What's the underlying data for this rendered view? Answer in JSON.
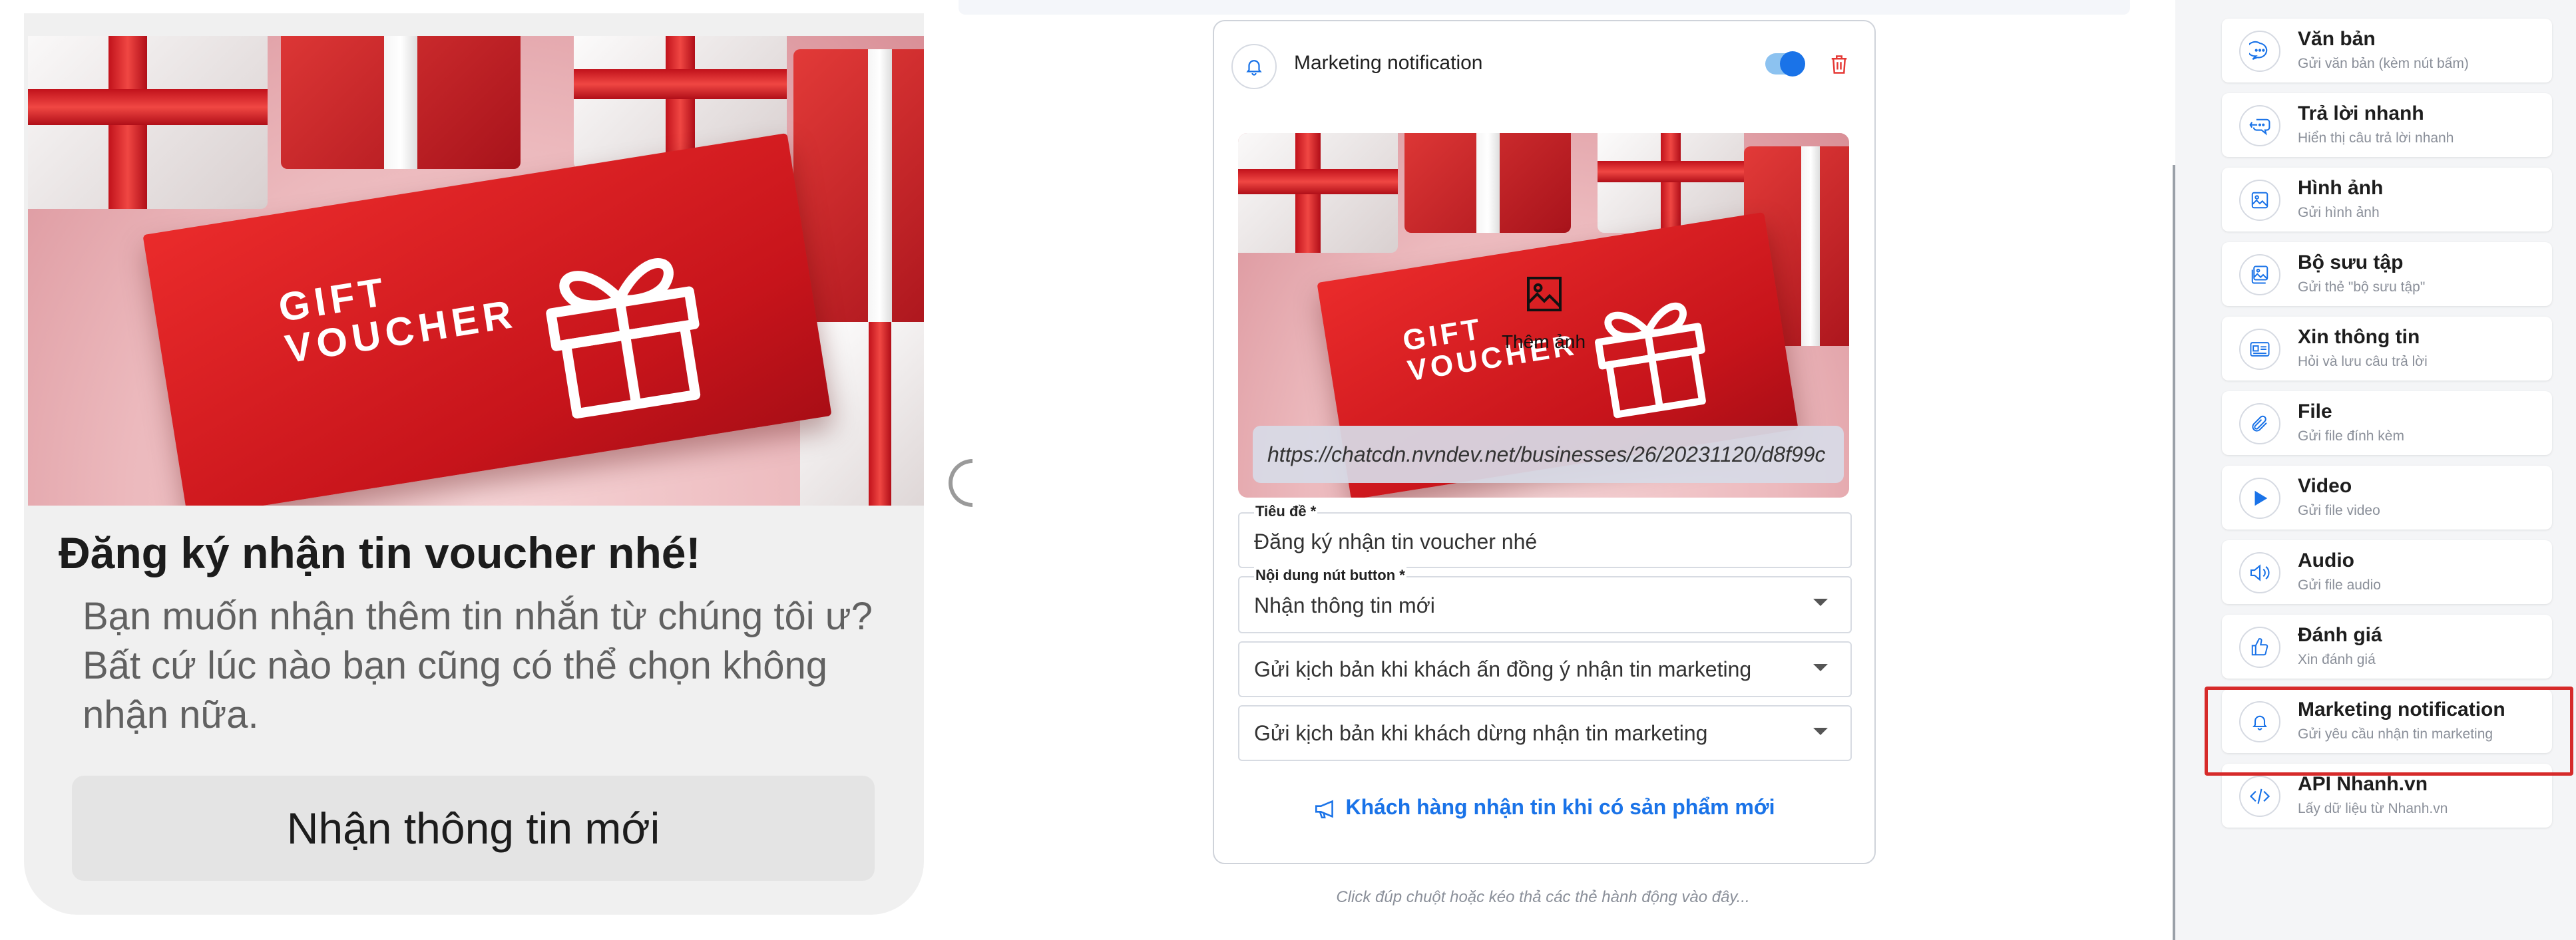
{
  "preview": {
    "card_text_line1": "GIFT",
    "card_text_line2": "VOUCHER",
    "title": "Đăng ký nhận tin voucher nhé!",
    "subtitle": "Bạn muốn nhận thêm tin nhắn từ chúng tôi ư? Bất cứ lúc nào bạn cũng có thể chọn không nhận nữa.",
    "button_label": "Nhận thông tin mới"
  },
  "editor": {
    "header_title": "Marketing notification",
    "toggle_on": true,
    "image": {
      "add_photo_label": "Thêm ảnh",
      "url": "https://chatcdn.nvndev.net/businesses/26/20231120/d8f99c"
    },
    "title_field": {
      "label": "Tiêu đề *",
      "value": "Đăng ký nhận tin voucher nhé"
    },
    "button_field": {
      "label": "Nội dung nút button *",
      "value": "Nhận thông tin mới"
    },
    "select_agree": {
      "value": "Gửi kịch bản khi khách ấn đồng ý nhận tin marketing"
    },
    "select_stop": {
      "value": "Gửi kịch bản khi khách dừng nhận tin marketing"
    },
    "cta_label": "Khách hàng nhận tin khi có sản phẩm mới",
    "accent_color": "#1a73e8",
    "delete_color": "#e53935"
  },
  "hint": "Click đúp chuột hoặc kéo thả các thẻ hành động vào đây...",
  "sidebar": {
    "items": [
      {
        "title": "Văn bản",
        "subtitle": "Gửi văn bản (kèm nút bấm)",
        "icon": "chat-bubble-icon"
      },
      {
        "title": "Trả lời nhanh",
        "subtitle": "Hiển thị câu trả lời nhanh",
        "icon": "quick-reply-icon"
      },
      {
        "title": "Hình ảnh",
        "subtitle": "Gửi hình ảnh",
        "icon": "image-icon"
      },
      {
        "title": "Bộ sưu tập",
        "subtitle": "Gửi thẻ \"bộ sưu tập\"",
        "icon": "gallery-icon"
      },
      {
        "title": "Xin thông tin",
        "subtitle": "Hỏi và lưu câu trả lời",
        "icon": "id-card-icon"
      },
      {
        "title": "File",
        "subtitle": "Gửi file đính kèm",
        "icon": "paperclip-icon"
      },
      {
        "title": "Video",
        "subtitle": "Gửi file video",
        "icon": "play-icon"
      },
      {
        "title": "Audio",
        "subtitle": "Gửi file audio",
        "icon": "speaker-icon"
      },
      {
        "title": "Đánh giá",
        "subtitle": "Xin đánh giá",
        "icon": "thumbs-up-icon"
      },
      {
        "title": "Marketing notification",
        "subtitle": "Gửi yêu cầu nhận tin marketing",
        "icon": "bell-icon"
      },
      {
        "title": "API Nhanh.vn",
        "subtitle": "Lấy dữ liệu từ Nhanh.vn",
        "icon": "code-icon"
      }
    ],
    "highlighted_item": "Marketing notification",
    "highlight_color": "#d62a2a"
  }
}
